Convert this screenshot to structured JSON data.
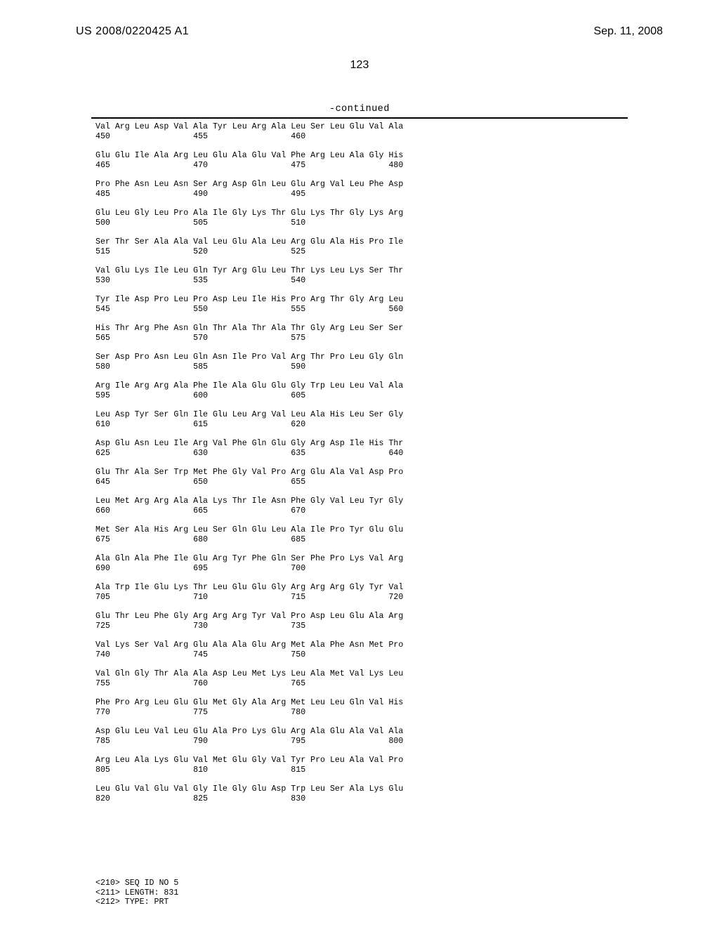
{
  "header": {
    "pub_number": "US 2008/0220425 A1",
    "pub_date": "Sep. 11, 2008",
    "page_number": "123",
    "continued_label": "-continued"
  },
  "sequence_rows": [
    {
      "aa": "Val Arg Leu Asp Val Ala Tyr Leu Arg Ala Leu Ser Leu Glu Val Ala",
      "nums": "450                 455                 460"
    },
    {
      "aa": "Glu Glu Ile Ala Arg Leu Glu Ala Glu Val Phe Arg Leu Ala Gly His",
      "nums": "465                 470                 475                 480"
    },
    {
      "aa": "Pro Phe Asn Leu Asn Ser Arg Asp Gln Leu Glu Arg Val Leu Phe Asp",
      "nums": "485                 490                 495"
    },
    {
      "aa": "Glu Leu Gly Leu Pro Ala Ile Gly Lys Thr Glu Lys Thr Gly Lys Arg",
      "nums": "500                 505                 510"
    },
    {
      "aa": "Ser Thr Ser Ala Ala Val Leu Glu Ala Leu Arg Glu Ala His Pro Ile",
      "nums": "515                 520                 525"
    },
    {
      "aa": "Val Glu Lys Ile Leu Gln Tyr Arg Glu Leu Thr Lys Leu Lys Ser Thr",
      "nums": "530                 535                 540"
    },
    {
      "aa": "Tyr Ile Asp Pro Leu Pro Asp Leu Ile His Pro Arg Thr Gly Arg Leu",
      "nums": "545                 550                 555                 560"
    },
    {
      "aa": "His Thr Arg Phe Asn Gln Thr Ala Thr Ala Thr Gly Arg Leu Ser Ser",
      "nums": "565                 570                 575"
    },
    {
      "aa": "Ser Asp Pro Asn Leu Gln Asn Ile Pro Val Arg Thr Pro Leu Gly Gln",
      "nums": "580                 585                 590"
    },
    {
      "aa": "Arg Ile Arg Arg Ala Phe Ile Ala Glu Glu Gly Trp Leu Leu Val Ala",
      "nums": "595                 600                 605"
    },
    {
      "aa": "Leu Asp Tyr Ser Gln Ile Glu Leu Arg Val Leu Ala His Leu Ser Gly",
      "nums": "610                 615                 620"
    },
    {
      "aa": "Asp Glu Asn Leu Ile Arg Val Phe Gln Glu Gly Arg Asp Ile His Thr",
      "nums": "625                 630                 635                 640"
    },
    {
      "aa": "Glu Thr Ala Ser Trp Met Phe Gly Val Pro Arg Glu Ala Val Asp Pro",
      "nums": "645                 650                 655"
    },
    {
      "aa": "Leu Met Arg Arg Ala Ala Lys Thr Ile Asn Phe Gly Val Leu Tyr Gly",
      "nums": "660                 665                 670"
    },
    {
      "aa": "Met Ser Ala His Arg Leu Ser Gln Glu Leu Ala Ile Pro Tyr Glu Glu",
      "nums": "675                 680                 685"
    },
    {
      "aa": "Ala Gln Ala Phe Ile Glu Arg Tyr Phe Gln Ser Phe Pro Lys Val Arg",
      "nums": "690                 695                 700"
    },
    {
      "aa": "Ala Trp Ile Glu Lys Thr Leu Glu Glu Gly Arg Arg Arg Gly Tyr Val",
      "nums": "705                 710                 715                 720"
    },
    {
      "aa": "Glu Thr Leu Phe Gly Arg Arg Arg Tyr Val Pro Asp Leu Glu Ala Arg",
      "nums": "725                 730                 735"
    },
    {
      "aa": "Val Lys Ser Val Arg Glu Ala Ala Glu Arg Met Ala Phe Asn Met Pro",
      "nums": "740                 745                 750"
    },
    {
      "aa": "Val Gln Gly Thr Ala Ala Asp Leu Met Lys Leu Ala Met Val Lys Leu",
      "nums": "755                 760                 765"
    },
    {
      "aa": "Phe Pro Arg Leu Glu Glu Met Gly Ala Arg Met Leu Leu Gln Val His",
      "nums": "770                 775                 780"
    },
    {
      "aa": "Asp Glu Leu Val Leu Glu Ala Pro Lys Glu Arg Ala Glu Ala Val Ala",
      "nums": "785                 790                 795                 800"
    },
    {
      "aa": "Arg Leu Ala Lys Glu Val Met Glu Gly Val Tyr Pro Leu Ala Val Pro",
      "nums": "805                 810                 815"
    },
    {
      "aa": "Leu Glu Val Glu Val Gly Ile Gly Glu Asp Trp Leu Ser Ala Lys Glu",
      "nums": "820                 825                 830"
    }
  ],
  "meta": {
    "line1": "<210> SEQ ID NO 5",
    "line2": "<211> LENGTH: 831",
    "line3": "<212> TYPE: PRT"
  }
}
